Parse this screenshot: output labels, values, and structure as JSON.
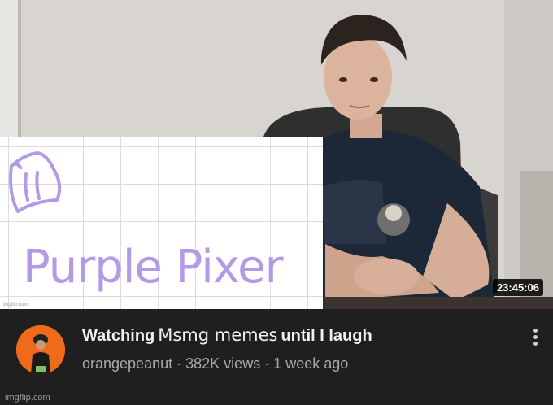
{
  "video": {
    "duration": "23:45:06",
    "title_part1": "Watching",
    "title_part2": "Msmg memes",
    "title_part3": "until I laugh"
  },
  "overlay": {
    "brand_text": "Purple Pixer",
    "small_credit": "imgflip.com"
  },
  "channel": {
    "name": "orangepeanut",
    "views": "382K views",
    "age": "1 week ago",
    "separator": "·",
    "avatar_color": "#f06a1c"
  },
  "watermark": "imgflip.com",
  "colors": {
    "accent_purple": "#b39ae6",
    "bar_bg": "#1f1f1f"
  }
}
